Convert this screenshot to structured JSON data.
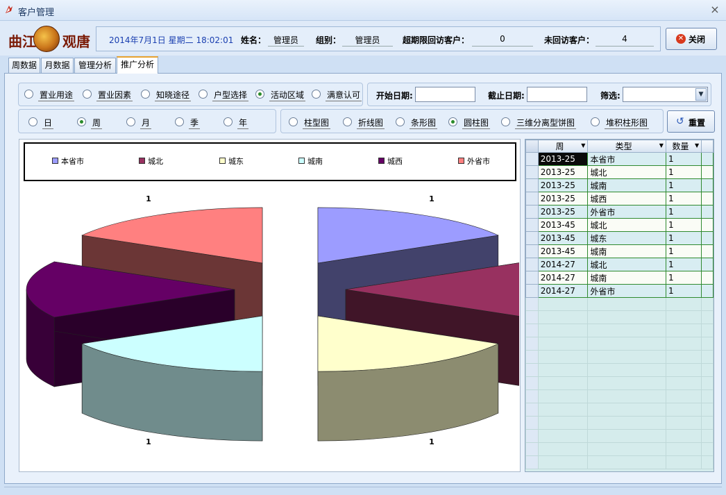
{
  "window": {
    "title": "客户管理",
    "close_glyph": "×"
  },
  "logo": {
    "left_text": "曲江",
    "right_text": "观唐"
  },
  "header": {
    "datetime": "2014年7月1日 星期二 18:02:01",
    "name_label": "姓名：",
    "name_value": "管理员",
    "group_label": "组别：",
    "group_value": "管理员",
    "overdue_label": "超期限回访客户：",
    "overdue_value": "0",
    "unvisited_label": "未回访客户：",
    "unvisited_value": "4",
    "close_label": "关闭"
  },
  "tabs": [
    {
      "label": "周数据"
    },
    {
      "label": "月数据"
    },
    {
      "label": "管理分析"
    },
    {
      "label": "推广分析",
      "active": true
    }
  ],
  "category_options": [
    {
      "label": "置业用途",
      "selected": false
    },
    {
      "label": "置业因素",
      "selected": false
    },
    {
      "label": "知晓途径",
      "selected": false
    },
    {
      "label": "户型选择",
      "selected": false
    },
    {
      "label": "活动区域",
      "selected": true
    },
    {
      "label": "满意认可",
      "selected": false
    }
  ],
  "filters": {
    "start_label": "开始日期:",
    "start_value": "",
    "end_label": "截止日期:",
    "end_value": "",
    "filter_label": "筛选:",
    "filter_value": ""
  },
  "period_options": [
    {
      "label": "日",
      "selected": false
    },
    {
      "label": "周",
      "selected": true
    },
    {
      "label": "月",
      "selected": false
    },
    {
      "label": "季",
      "selected": false
    },
    {
      "label": "年",
      "selected": false
    }
  ],
  "chart_type_options": [
    {
      "label": "柱型图",
      "selected": false
    },
    {
      "label": "折线图",
      "selected": false
    },
    {
      "label": "条形图",
      "selected": false
    },
    {
      "label": "圆柱图",
      "selected": true
    },
    {
      "label": "三维分离型饼图",
      "selected": false
    },
    {
      "label": "堆积柱形图",
      "selected": false
    }
  ],
  "reset_label": "重置",
  "chart_data": {
    "type": "pie",
    "style": "3d-exploded",
    "categories": [
      "本省市",
      "城北",
      "城东",
      "城南",
      "城西",
      "外省市"
    ],
    "values": [
      1,
      1,
      1,
      1,
      1,
      1
    ],
    "data_labels": [
      "1",
      "1",
      "1",
      "1",
      "1",
      "1"
    ],
    "colors": [
      "#9c9cff",
      "#983160",
      "#ffffcc",
      "#ccffff",
      "#650065",
      "#ff8080"
    ],
    "legend_position": "top"
  },
  "grid": {
    "columns": [
      "周",
      "类型",
      "数量"
    ],
    "rows": [
      [
        "2013-25",
        "本省市",
        "1"
      ],
      [
        "2013-25",
        "城北",
        "1"
      ],
      [
        "2013-25",
        "城南",
        "1"
      ],
      [
        "2013-25",
        "城西",
        "1"
      ],
      [
        "2013-25",
        "外省市",
        "1"
      ],
      [
        "2013-45",
        "城北",
        "1"
      ],
      [
        "2013-45",
        "城东",
        "1"
      ],
      [
        "2013-45",
        "城南",
        "1"
      ],
      [
        "2014-27",
        "城北",
        "1"
      ],
      [
        "2014-27",
        "城南",
        "1"
      ],
      [
        "2014-27",
        "外省市",
        "1"
      ]
    ]
  }
}
